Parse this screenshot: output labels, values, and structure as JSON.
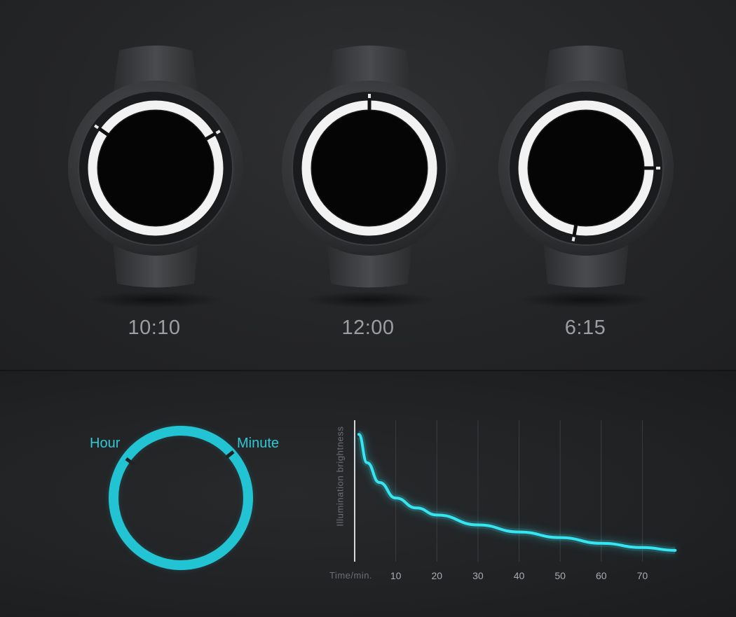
{
  "watches": [
    {
      "time_label": "10:10",
      "hour_gap_angle": 305,
      "minute_gap_angle": 60
    },
    {
      "time_label": "12:00",
      "hour_gap_angle": 0,
      "minute_gap_angle": 0
    },
    {
      "time_label": "6:15",
      "hour_gap_angle": 190,
      "minute_gap_angle": 90
    }
  ],
  "dial_legend": {
    "hour_label": "Hour",
    "minute_label": "Minute",
    "color": "#2ec8d6"
  },
  "chart_data": {
    "type": "line",
    "ylabel": "Illumination brightness",
    "xlabel": "Time/min.",
    "x_ticks": [
      10,
      20,
      30,
      40,
      50,
      60,
      70
    ],
    "xlim": [
      0,
      80
    ],
    "grid": true,
    "series": [
      {
        "x": [
          1,
          3,
          6,
          10,
          15,
          20,
          30,
          40,
          50,
          60,
          70,
          78
        ],
        "y": [
          0.9,
          0.7,
          0.56,
          0.45,
          0.38,
          0.33,
          0.26,
          0.21,
          0.17,
          0.13,
          0.1,
          0.08
        ]
      }
    ],
    "color": "#35e6f2"
  }
}
